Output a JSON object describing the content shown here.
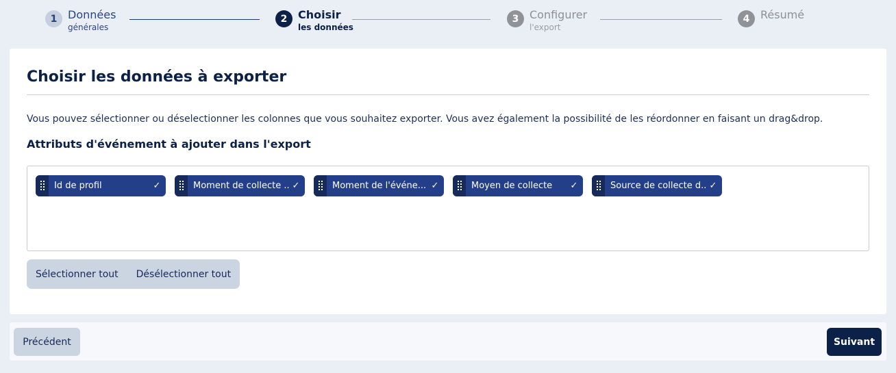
{
  "stepper": {
    "steps": [
      {
        "number": "1",
        "title": "Données",
        "subtitle": "générales",
        "state": "done"
      },
      {
        "number": "2",
        "title": "Choisir",
        "subtitle": "les données",
        "state": "active"
      },
      {
        "number": "3",
        "title": "Configurer",
        "subtitle": "l'export",
        "state": "todo"
      },
      {
        "number": "4",
        "title": "Résumé",
        "subtitle": "",
        "state": "todo"
      }
    ]
  },
  "card": {
    "title": "Choisir les données à exporter",
    "description": "Vous pouvez sélectionner ou déselectionner les colonnes que vous souhaitez exporter. Vous avez également la possibilité de les réordonner en faisant un drag&drop.",
    "section_title": "Attributs d'événement à ajouter dans l'export",
    "chips": [
      {
        "label": "Id de profil",
        "checked": true
      },
      {
        "label": "Moment de collecte ...",
        "checked": true
      },
      {
        "label": "Moment de l'événe...",
        "checked": true
      },
      {
        "label": "Moyen de collecte",
        "checked": true
      },
      {
        "label": "Source de collecte d...",
        "checked": true
      }
    ],
    "select_all_label": "Sélectionner tout",
    "deselect_all_label": "Désélectionner tout"
  },
  "footer": {
    "previous_label": "Précédent",
    "next_label": "Suivant"
  },
  "icons": {
    "chip_handle": "drag-handle-icon",
    "chip_check": "check-icon"
  },
  "colors": {
    "brand_dark": "#0c2148",
    "chip_bg": "#243f8a",
    "page_bg": "#eaeef5",
    "secondary_btn": "#cbd5e1"
  }
}
